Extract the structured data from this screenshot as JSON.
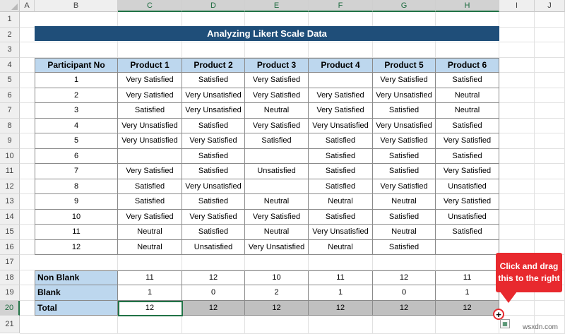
{
  "columns": [
    "A",
    "B",
    "C",
    "D",
    "E",
    "F",
    "G",
    "H",
    "I",
    "J"
  ],
  "rows": [
    "1",
    "2",
    "3",
    "4",
    "5",
    "6",
    "7",
    "8",
    "9",
    "10",
    "11",
    "12",
    "13",
    "14",
    "15",
    "16",
    "17",
    "18",
    "19",
    "20",
    "21"
  ],
  "title": "Analyzing Likert Scale Data",
  "table": {
    "headers": [
      "Participant No",
      "Product 1",
      "Product 2",
      "Product 3",
      "Product 4",
      "Product 5",
      "Product 6"
    ],
    "rows": [
      [
        "1",
        "Very Satisfied",
        "Satisfied",
        "Very Satisfied",
        "",
        "Very Satisfied",
        "Satisfied"
      ],
      [
        "2",
        "Very Satisfied",
        "Very Unsatisfied",
        "Very Satisfied",
        "Very Satisfied",
        "Very Unsatisfied",
        "Neutral"
      ],
      [
        "3",
        "Satisfied",
        "Very Unsatisfied",
        "Neutral",
        "Very Satisfied",
        "Satisfied",
        "Neutral"
      ],
      [
        "4",
        "Very Unsatisfied",
        "Satisfied",
        "Very Satisfied",
        "Very Unsatisfied",
        "Very Unsatisfied",
        "Satisfied"
      ],
      [
        "5",
        "Very Unsatisfied",
        "Very Satisfied",
        "Satisfied",
        "Satisfied",
        "Very Satisfied",
        "Very Satisfied"
      ],
      [
        "6",
        "",
        "Satisfied",
        "",
        "Satisfied",
        "Satisfied",
        "Satisfied"
      ],
      [
        "7",
        "Very Satisfied",
        "Satisfied",
        "Unsatisfied",
        "Satisfied",
        "Satisfied",
        "Very Satisfied"
      ],
      [
        "8",
        "Satisfied",
        "Very Unsatisfied",
        "",
        "Satisfied",
        "Very Satisfied",
        "Unsatisfied"
      ],
      [
        "9",
        "Satisfied",
        "Satisfied",
        "Neutral",
        "Neutral",
        "Neutral",
        "Very Satisfied"
      ],
      [
        "10",
        "Very Satisfied",
        "Very Satisfied",
        "Very Satisfied",
        "Satisfied",
        "Satisfied",
        "Unsatisfied"
      ],
      [
        "11",
        "Neutral",
        "Satisfied",
        "Neutral",
        "Very Unsatisfied",
        "Neutral",
        "Satisfied"
      ],
      [
        "12",
        "Neutral",
        "Unsatisfied",
        "Very Unsatisfied",
        "Neutral",
        "Satisfied",
        ""
      ]
    ]
  },
  "summary": [
    {
      "label": "Non Blank",
      "values": [
        "11",
        "12",
        "10",
        "11",
        "12",
        "11"
      ]
    },
    {
      "label": "Blank",
      "values": [
        "1",
        "0",
        "2",
        "1",
        "0",
        "1"
      ]
    },
    {
      "label": "Total",
      "values": [
        "12",
        "12",
        "12",
        "12",
        "12",
        "12"
      ]
    }
  ],
  "callout": {
    "text": "Click and drag this to the right"
  },
  "fill_handle": {
    "symbol": "+"
  },
  "watermark": "wsxdn.com",
  "colors": {
    "title_bg": "#1f4e79",
    "header_bg": "#bdd7ee",
    "selection": "#217346",
    "callout": "#e8292e",
    "filled": "#c0c0c0"
  }
}
